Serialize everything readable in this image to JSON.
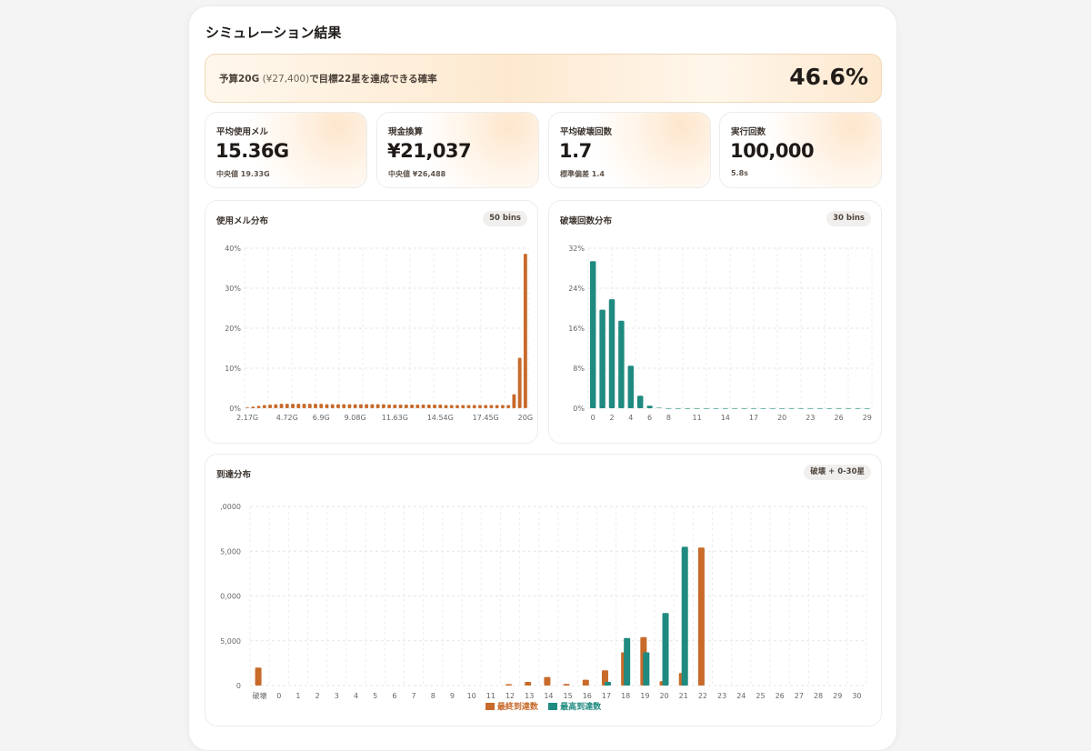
{
  "results": {
    "title": "シミュレーション結果",
    "banner": {
      "text_prefix": "予算20G",
      "text_muted": " (¥27,400)",
      "text_suffix": "で目標22星を達成できる確率",
      "probability": "46.6%"
    },
    "stats": [
      {
        "label": "平均使用メル",
        "value": "15.36G",
        "sub": "中央値 19.33G"
      },
      {
        "label": "現金換算",
        "value": "¥21,037",
        "sub": "中央値 ¥26,488"
      },
      {
        "label": "平均破壊回数",
        "value": "1.7",
        "sub": "標準偏差 1.4"
      },
      {
        "label": "実行回数",
        "value": "100,000",
        "sub": "5.8s"
      }
    ]
  },
  "charts_meta": {
    "mel": {
      "title": "使用メル分布",
      "badge": "50 bins"
    },
    "destroy": {
      "title": "破壊回数分布",
      "badge": "30 bins"
    },
    "reach": {
      "title": "到達分布",
      "badge": "破壊 + 0-30星"
    }
  },
  "colors": {
    "orange": "#c86a2a",
    "teal": "#1f8a80"
  },
  "chart_data": [
    {
      "type": "bar",
      "title": "使用メル分布",
      "x_tick_labels": [
        "2.17G",
        "4.72G",
        "6.9G",
        "9.08G",
        "11.63G",
        "14.54G",
        "17.45G",
        "20G"
      ],
      "y_ticks": [
        "0%",
        "10%",
        "20%",
        "30%",
        "40%"
      ],
      "ylim": [
        0,
        40
      ],
      "values": [
        0.2,
        0.4,
        0.6,
        0.8,
        0.9,
        1.0,
        1.1,
        1.1,
        1.1,
        1.1,
        1.1,
        1.1,
        1.1,
        1.1,
        1.0,
        1.0,
        1.0,
        1.0,
        1.0,
        1.0,
        1.0,
        1.0,
        1.0,
        1.0,
        1.0,
        0.9,
        0.9,
        0.9,
        0.9,
        0.9,
        0.9,
        0.9,
        0.9,
        0.9,
        0.9,
        0.8,
        0.8,
        0.8,
        0.8,
        0.8,
        0.8,
        0.8,
        0.8,
        0.8,
        0.8,
        0.8,
        0.8,
        3.5,
        12.6,
        38.6
      ],
      "color": "#c86a2a"
    },
    {
      "type": "bar",
      "title": "破壊回数分布",
      "x_tick_labels": [
        "0",
        "2",
        "4",
        "6",
        "8",
        "11",
        "14",
        "17",
        "20",
        "23",
        "26",
        "29"
      ],
      "y_ticks": [
        "0%",
        "8%",
        "16%",
        "24%",
        "32%"
      ],
      "ylim": [
        0,
        32
      ],
      "values": [
        29.4,
        19.7,
        21.8,
        17.5,
        8.5,
        2.5,
        0.5,
        0.1,
        0,
        0,
        0,
        0,
        0,
        0,
        0,
        0,
        0,
        0,
        0,
        0,
        0,
        0,
        0,
        0,
        0,
        0,
        0,
        0,
        0,
        0
      ],
      "color": "#1f8a80"
    },
    {
      "type": "bar",
      "title": "到達分布",
      "categories": [
        "破壊",
        "0",
        "1",
        "2",
        "3",
        "4",
        "5",
        "6",
        "7",
        "8",
        "9",
        "10",
        "11",
        "12",
        "13",
        "14",
        "15",
        "16",
        "17",
        "18",
        "19",
        "20",
        "21",
        "22",
        "23",
        "24",
        "25",
        "26",
        "27",
        "28",
        "29",
        "30"
      ],
      "y_ticks": [
        "0",
        "5,000",
        "0,000",
        "5,000",
        ",0000"
      ],
      "ylim": [
        0,
        20000
      ],
      "series": [
        {
          "name": "最終到達数",
          "color": "#c86a2a",
          "values": [
            2000,
            0,
            0,
            0,
            0,
            0,
            0,
            0,
            0,
            0,
            0,
            0,
            0,
            150,
            400,
            950,
            180,
            650,
            1700,
            3700,
            5400,
            500,
            1400,
            15400,
            0,
            0,
            0,
            0,
            0,
            0,
            0,
            0
          ]
        },
        {
          "name": "最高到達数",
          "color": "#1f8a80",
          "values": [
            0,
            0,
            0,
            0,
            0,
            0,
            0,
            0,
            0,
            0,
            0,
            0,
            0,
            0,
            0,
            0,
            0,
            0,
            400,
            5300,
            3700,
            8100,
            15500,
            0,
            0,
            0,
            0,
            0,
            0,
            0,
            0,
            0
          ]
        }
      ]
    }
  ]
}
